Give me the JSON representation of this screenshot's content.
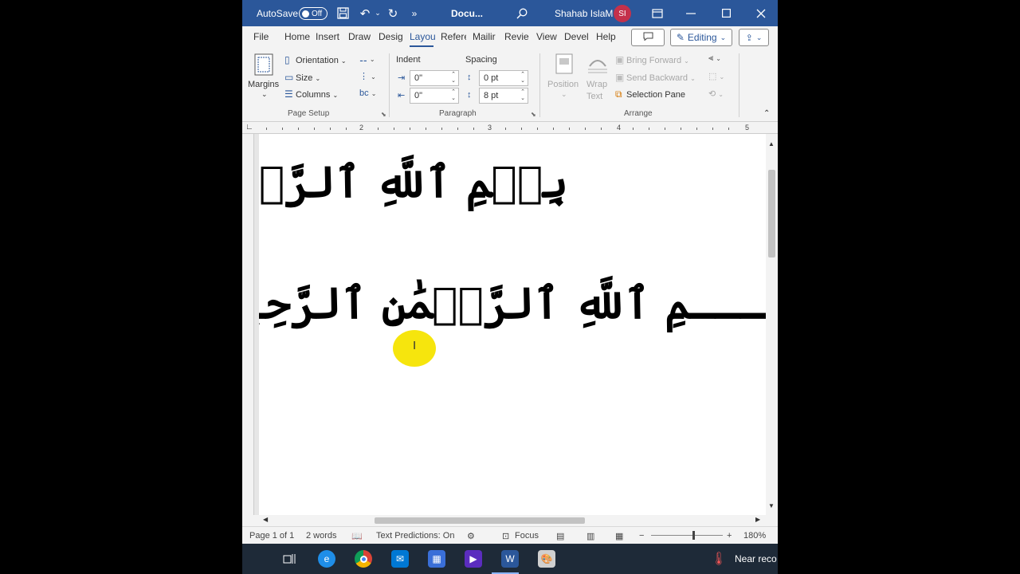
{
  "titlebar": {
    "autosave_label": "AutoSave",
    "autosave_state": "Off",
    "doc_title": "Docu...",
    "user_name": "Shahab IslaM",
    "user_initials": "SI"
  },
  "tabs": [
    "File",
    "Home",
    "Insert",
    "Draw",
    "Desig",
    "Layou",
    "Refere",
    "Mailir",
    "Revie",
    "View",
    "Devel",
    "Help"
  ],
  "active_tab": "Layou",
  "editing_label": "Editing",
  "ribbon": {
    "page_setup": {
      "margins": "Margins",
      "orientation": "Orientation",
      "size": "Size",
      "columns": "Columns",
      "label": "Page Setup"
    },
    "paragraph": {
      "indent_label": "Indent",
      "spacing_label": "Spacing",
      "indent_left": "0\"",
      "indent_right": "0\"",
      "spacing_before": "0 pt",
      "spacing_after": "8 pt",
      "label": "Paragraph"
    },
    "arrange": {
      "position": "Position",
      "wrap_text_1": "Wrap",
      "wrap_text_2": "Text",
      "bring_forward": "Bring Forward",
      "send_backward": "Send Backward",
      "selection_pane": "Selection Pane",
      "label": "Arrange"
    }
  },
  "ruler_numbers": [
    "2",
    "3",
    "4",
    "5"
  ],
  "document": {
    "line1": "بِسۡمِ ٱللَّهِ ٱلرَّحۡمَٰنِ ٱلرَّ",
    "line2": "ـــمِ ٱللَّهِ ٱلرَّحۡمَٰنِ ٱلرَّحِيـــمِ"
  },
  "statusbar": {
    "page": "Page 1 of 1",
    "words": "2 words",
    "text_predictions": "Text Predictions: On",
    "focus": "Focus",
    "zoom": "180%"
  },
  "taskbar": {
    "weather_text": "Near reco"
  }
}
